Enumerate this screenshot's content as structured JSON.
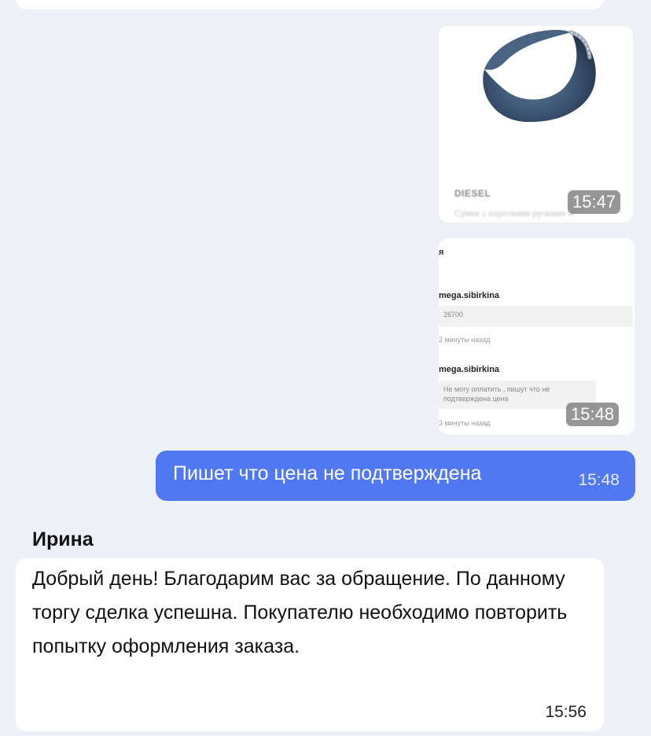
{
  "product_message": {
    "brand": "DIESEL",
    "description": "Сумки с короткими ручками м",
    "time": "15:47"
  },
  "screenshot_message": {
    "header": "я",
    "entries": [
      {
        "user": "mega.sibirkina",
        "text": "26700",
        "ago": "2 минуты назад"
      },
      {
        "user": "mega.sibirkina",
        "text": "Не могу оплатить , пишут что не подтверждена цена",
        "ago": "3 минуты назад"
      }
    ],
    "time": "15:48"
  },
  "outgoing_message": {
    "text": "Пишет что цена не подтверждена",
    "time": "15:48"
  },
  "incoming_message": {
    "sender": "Ирина",
    "text": "Добрый день! Благодарим вас за обращение. По данному торгу сделка успешна. Покупателю необходимо повторить попытку оформления заказа.",
    "time": "15:56"
  },
  "colors": {
    "background": "#eef0f7",
    "outgoing_bubble": "#5078f2",
    "incoming_bubble": "#ffffff"
  }
}
